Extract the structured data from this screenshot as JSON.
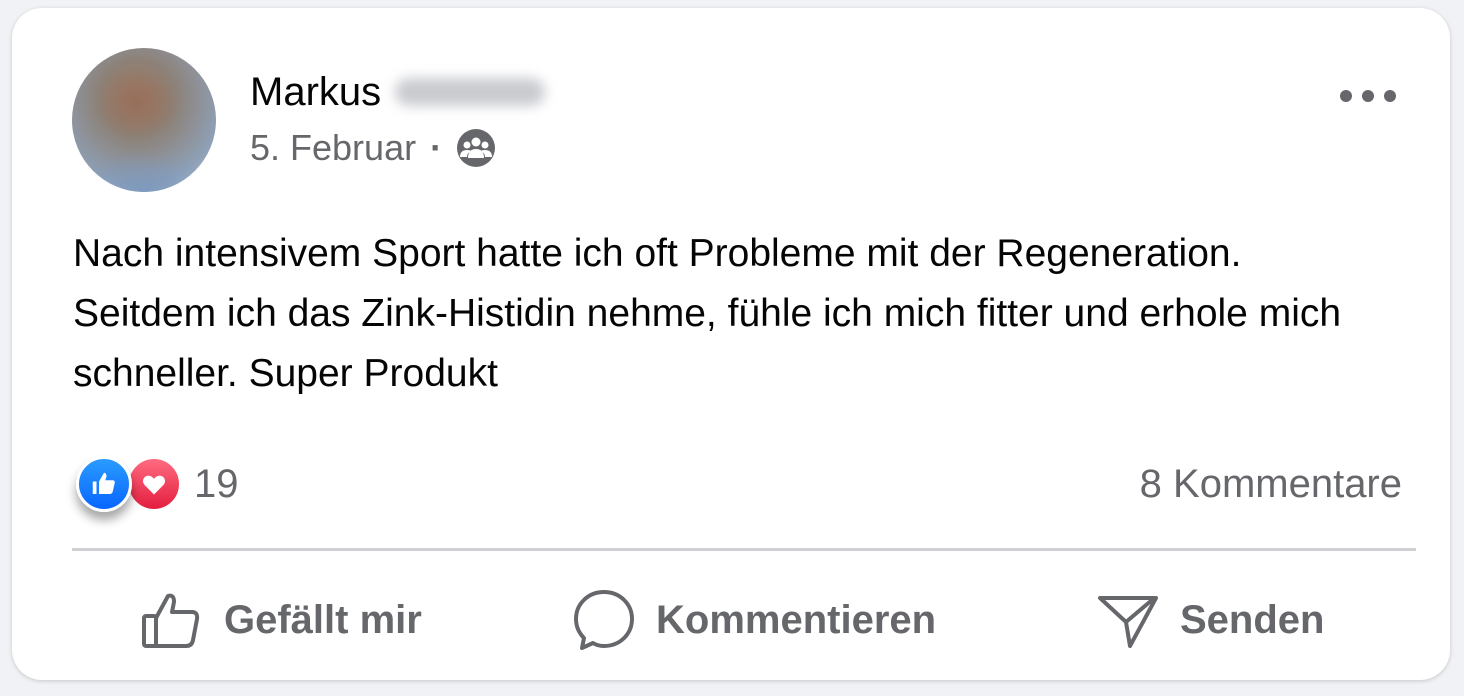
{
  "post": {
    "author_first_name": "Markus",
    "date": "5. Februar",
    "separator": "·",
    "audience_icon": "group-icon",
    "text": "Nach intensivem Sport hatte ich oft Probleme mit der Regeneration. Seitdem ich das Zink-Histidin nehme, fühle ich mich fitter und erhole mich schneller. Super Produkt",
    "reaction_icons": [
      "like-reaction-icon",
      "love-reaction-icon"
    ],
    "reaction_count": "19",
    "comment_count_label": "8 Kommentare"
  },
  "actions": {
    "like_label": "Gefällt mir",
    "comment_label": "Kommentieren",
    "share_label": "Senden"
  },
  "colors": {
    "like_blue": "#0866ff",
    "love_red": "#e41e3f",
    "secondary_text": "#65676b",
    "primary_text": "#050505"
  }
}
